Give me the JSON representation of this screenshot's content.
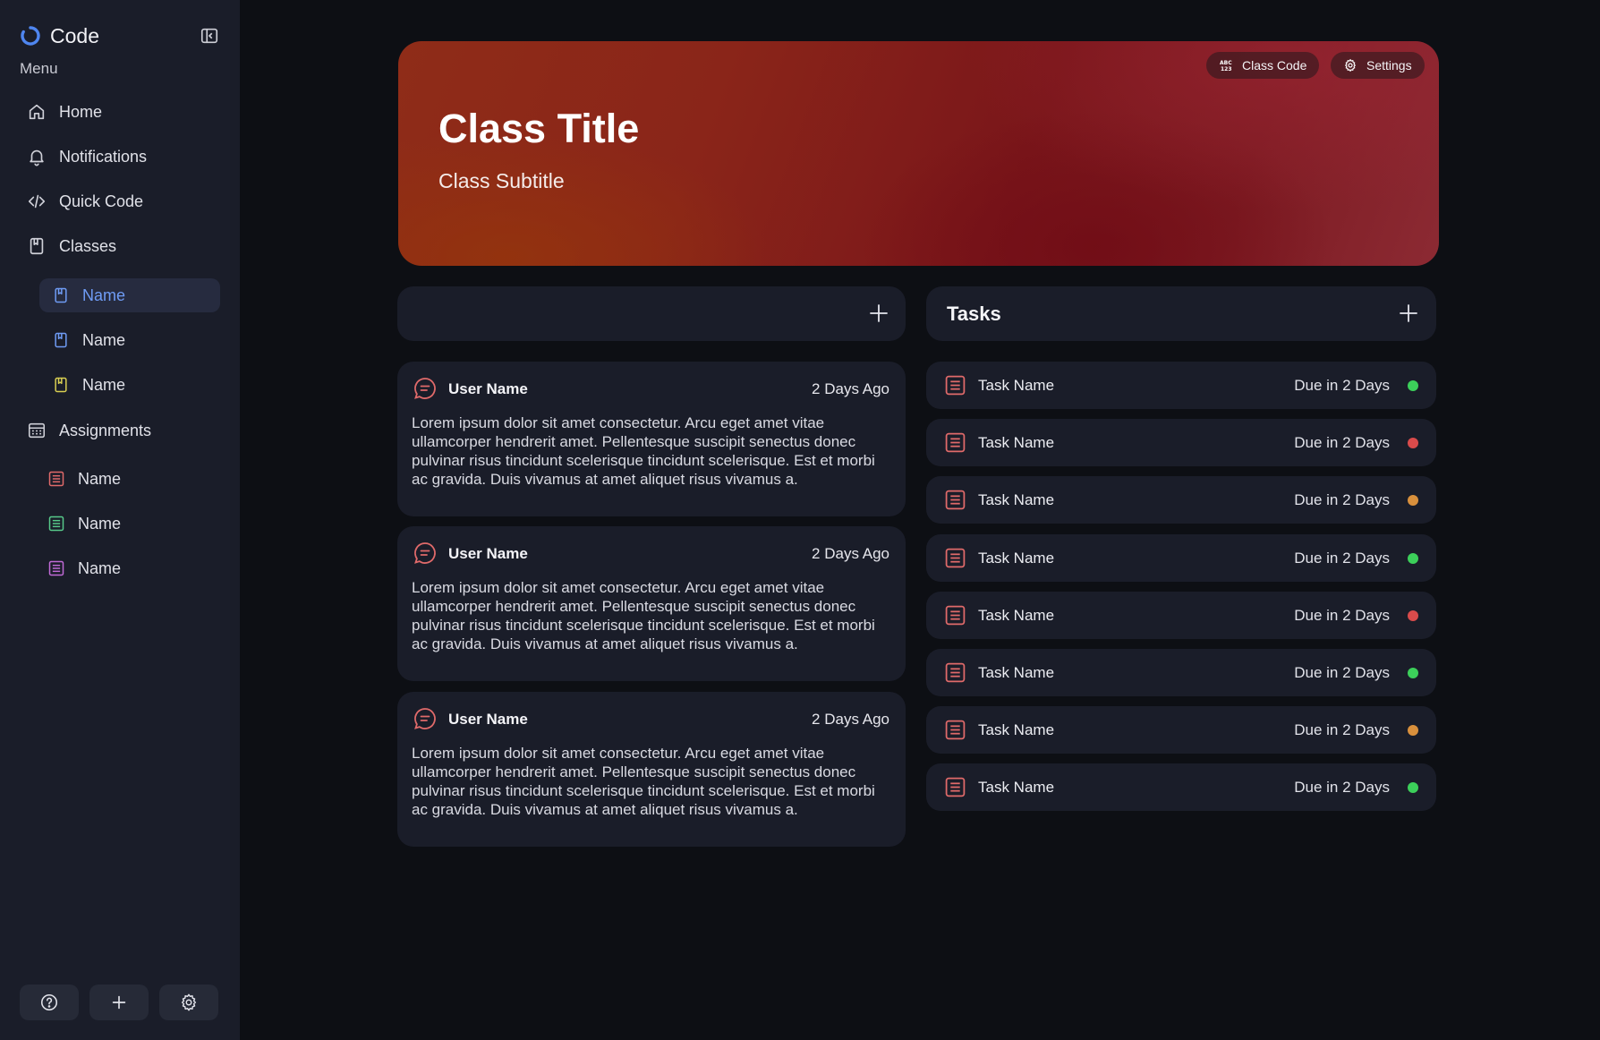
{
  "brand": {
    "name": "Code",
    "logo_icon": "spinner-logo-icon"
  },
  "sidebar": {
    "menu_label": "Menu",
    "nav": [
      {
        "label": "Home",
        "icon": "home-icon"
      },
      {
        "label": "Notifications",
        "icon": "bell-icon"
      },
      {
        "label": "Quick Code",
        "icon": "code-icon"
      },
      {
        "label": "Classes",
        "icon": "bookmark-icon"
      }
    ],
    "classes": [
      {
        "label": "Name",
        "color": "#6f9cf5",
        "active": true
      },
      {
        "label": "Name",
        "color": "#6f9cf5",
        "active": false
      },
      {
        "label": "Name",
        "color": "#d9cf52",
        "active": false
      }
    ],
    "assignments_label": "Assignments",
    "assignments": [
      {
        "label": "Name",
        "color": "#e06a6a"
      },
      {
        "label": "Name",
        "color": "#57c98a"
      },
      {
        "label": "Name",
        "color": "#c06ad6"
      }
    ],
    "bottom_icons": [
      "help-icon",
      "plus-icon",
      "gear-icon"
    ]
  },
  "banner": {
    "title": "Class Title",
    "subtitle": "Class Subtitle",
    "class_code_label": "Class Code",
    "settings_label": "Settings"
  },
  "feed": {
    "posts": [
      {
        "user": "User Name",
        "time": "2 Days Ago",
        "body": "Lorem ipsum dolor sit amet consectetur. Arcu eget amet vitae ullamcorper hendrerit amet. Pellentesque suscipit senectus donec pulvinar risus tincidunt scelerisque tincidunt scelerisque. Est et morbi ac gravida. Duis vivamus at amet aliquet risus vivamus a."
      },
      {
        "user": "User Name",
        "time": "2 Days Ago",
        "body": "Lorem ipsum dolor sit amet consectetur. Arcu eget amet vitae ullamcorper hendrerit amet. Pellentesque suscipit senectus donec pulvinar risus tincidunt scelerisque tincidunt scelerisque. Est et morbi ac gravida. Duis vivamus at amet aliquet risus vivamus a."
      },
      {
        "user": "User Name",
        "time": "2 Days Ago",
        "body": "Lorem ipsum dolor sit amet consectetur. Arcu eget amet vitae ullamcorper hendrerit amet. Pellentesque suscipit senectus donec pulvinar risus tincidunt scelerisque tincidunt scelerisque. Est et morbi ac gravida. Duis vivamus at amet aliquet risus vivamus a."
      }
    ]
  },
  "tasks": {
    "title": "Tasks",
    "items": [
      {
        "name": "Task Name",
        "due": "Due in 2 Days",
        "status_color": "#3ccf5a"
      },
      {
        "name": "Task Name",
        "due": "Due in 2 Days",
        "status_color": "#d94b4b"
      },
      {
        "name": "Task Name",
        "due": "Due in 2 Days",
        "status_color": "#d9903c"
      },
      {
        "name": "Task Name",
        "due": "Due in 2 Days",
        "status_color": "#3ccf5a"
      },
      {
        "name": "Task Name",
        "due": "Due in 2 Days",
        "status_color": "#d94b4b"
      },
      {
        "name": "Task Name",
        "due": "Due in 2 Days",
        "status_color": "#3ccf5a"
      },
      {
        "name": "Task Name",
        "due": "Due in 2 Days",
        "status_color": "#d9903c"
      },
      {
        "name": "Task Name",
        "due": "Due in 2 Days",
        "status_color": "#3ccf5a"
      }
    ]
  },
  "colors": {
    "accent_blue": "#6f9cf5",
    "post_icon": "#e06a6a",
    "task_icon": "#e06a6a"
  }
}
